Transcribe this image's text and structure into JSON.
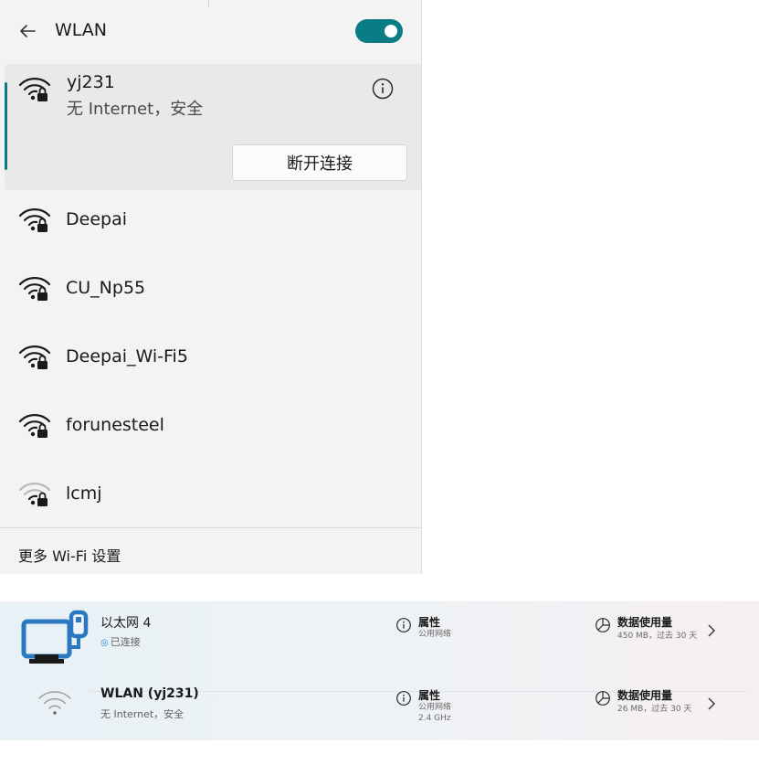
{
  "wlan_flyout": {
    "title": "WLAN",
    "toggle_on": true,
    "accent_color": "#0a7c85",
    "connected_network": {
      "name": "yj231",
      "status": "无 Internet，安全",
      "disconnect_label": "断开连接",
      "icon": "wifi-secured-icon",
      "info_icon": "info-icon"
    },
    "networks": [
      {
        "name": "Deepai",
        "icon": "wifi-secured-icon",
        "signal": "full"
      },
      {
        "name": "CU_Np55",
        "icon": "wifi-secured-icon",
        "signal": "full"
      },
      {
        "name": "Deepai_Wi-Fi5",
        "icon": "wifi-secured-icon",
        "signal": "full"
      },
      {
        "name": "forunesteel",
        "icon": "wifi-secured-icon",
        "signal": "full"
      },
      {
        "name": "lcmj",
        "icon": "wifi-secured-icon",
        "signal": "weak"
      }
    ],
    "footer_link": "更多 Wi-Fi 设置"
  },
  "connections": [
    {
      "name": "以太网 4",
      "status": "已连接",
      "status_icon": "globe-icon",
      "icon": "ethernet-icon",
      "properties_label": "属性",
      "properties_sub": [
        "公用网络"
      ],
      "usage_label": "数据使用量",
      "usage_sub": "450 MB，过去 30 天"
    },
    {
      "name": "WLAN (yj231)",
      "status": "无 Internet，安全",
      "icon": "wifi-icon",
      "properties_label": "属性",
      "properties_sub": [
        "公用网络",
        "2.4 GHz"
      ],
      "usage_label": "数据使用量",
      "usage_sub": "26 MB，过去 30 天"
    }
  ]
}
